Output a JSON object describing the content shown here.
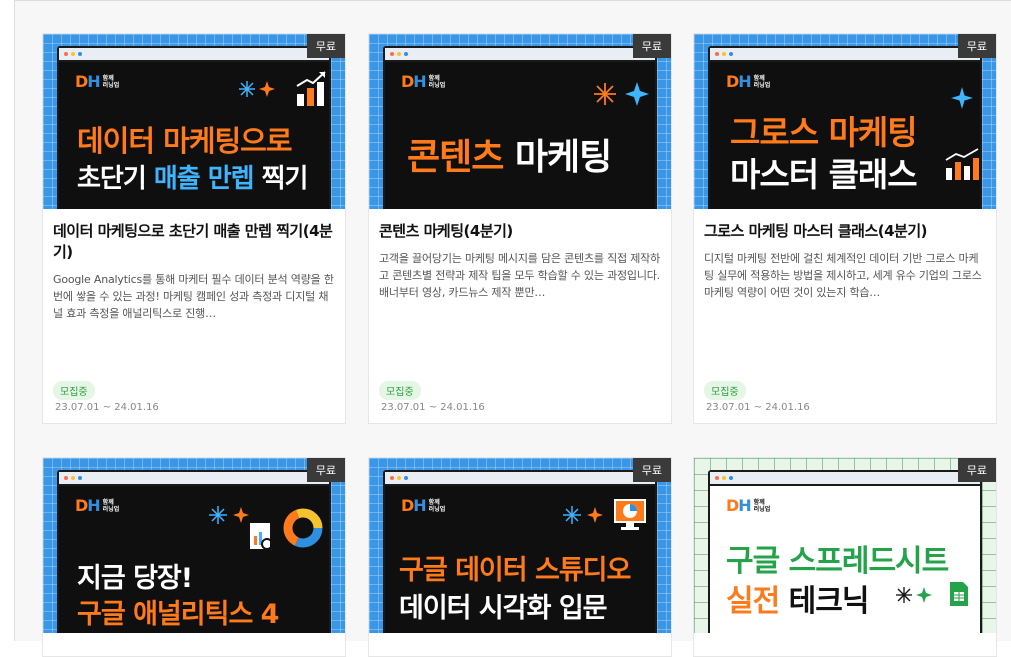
{
  "badge_label": "무료",
  "logo": {
    "mark_d": "D",
    "mark_h": "H",
    "sub_1": "함께",
    "sub_2": "러닝업"
  },
  "cards": [
    {
      "thumb_lines": [
        "데이터 마케팅으로",
        "초단기",
        "매출 만렙",
        "찍기"
      ],
      "title": "데이터 마케팅으로 초단기 매출 만렙 찍기(4분기)",
      "desc": "Google Analytics를 통해 마케터 필수 데이터 분석 역량을 한 번에 쌓을 수 있는 과정! 마케팅 캠페인 성과 측정과 디지털 채널 효과 측정을 애널리틱스로 진행…",
      "status": "모집중",
      "date": "23.07.01 ~ 24.01.16"
    },
    {
      "thumb_lines": [
        "콘텐츠",
        "마케팅"
      ],
      "title": "콘텐츠 마케팅(4분기)",
      "desc": "고객을 끌어당기는 마케팅 메시지를 담은 콘텐츠를 직접 제작하고 콘텐츠별 전략과 제작 팁을 모두 학습할 수 있는 과정입니다. 배너부터 영상, 카드뉴스 제작 뿐만…",
      "status": "모집중",
      "date": "23.07.01 ~ 24.01.16"
    },
    {
      "thumb_lines": [
        "그로스 마케팅",
        "마스터 클래스"
      ],
      "title": "그로스 마케팅 마스터 클래스(4분기)",
      "desc": "디지털 마케팅 전반에 걸친 체계적인 데이터 기반 그로스 마케팅 실무에 적용하는 방법을 제시하고, 세계 유수 기업의 그로스 마케팅 역량이 어떤 것이 있는지 학습…",
      "status": "모집중",
      "date": "23.07.01 ~ 24.01.16"
    },
    {
      "thumb_lines": [
        "지금 당장!",
        "구글 애널리틱스 4"
      ]
    },
    {
      "thumb_lines": [
        "구글 데이터 스튜디오",
        "데이터 시각화 입문"
      ]
    },
    {
      "thumb_lines": [
        "구글 스프레드시트",
        "실전",
        "테크닉"
      ]
    }
  ],
  "colors": {
    "accent_orange": "#ff7a1a",
    "accent_blue": "#2f8fe0",
    "accent_green": "#24a34a"
  }
}
